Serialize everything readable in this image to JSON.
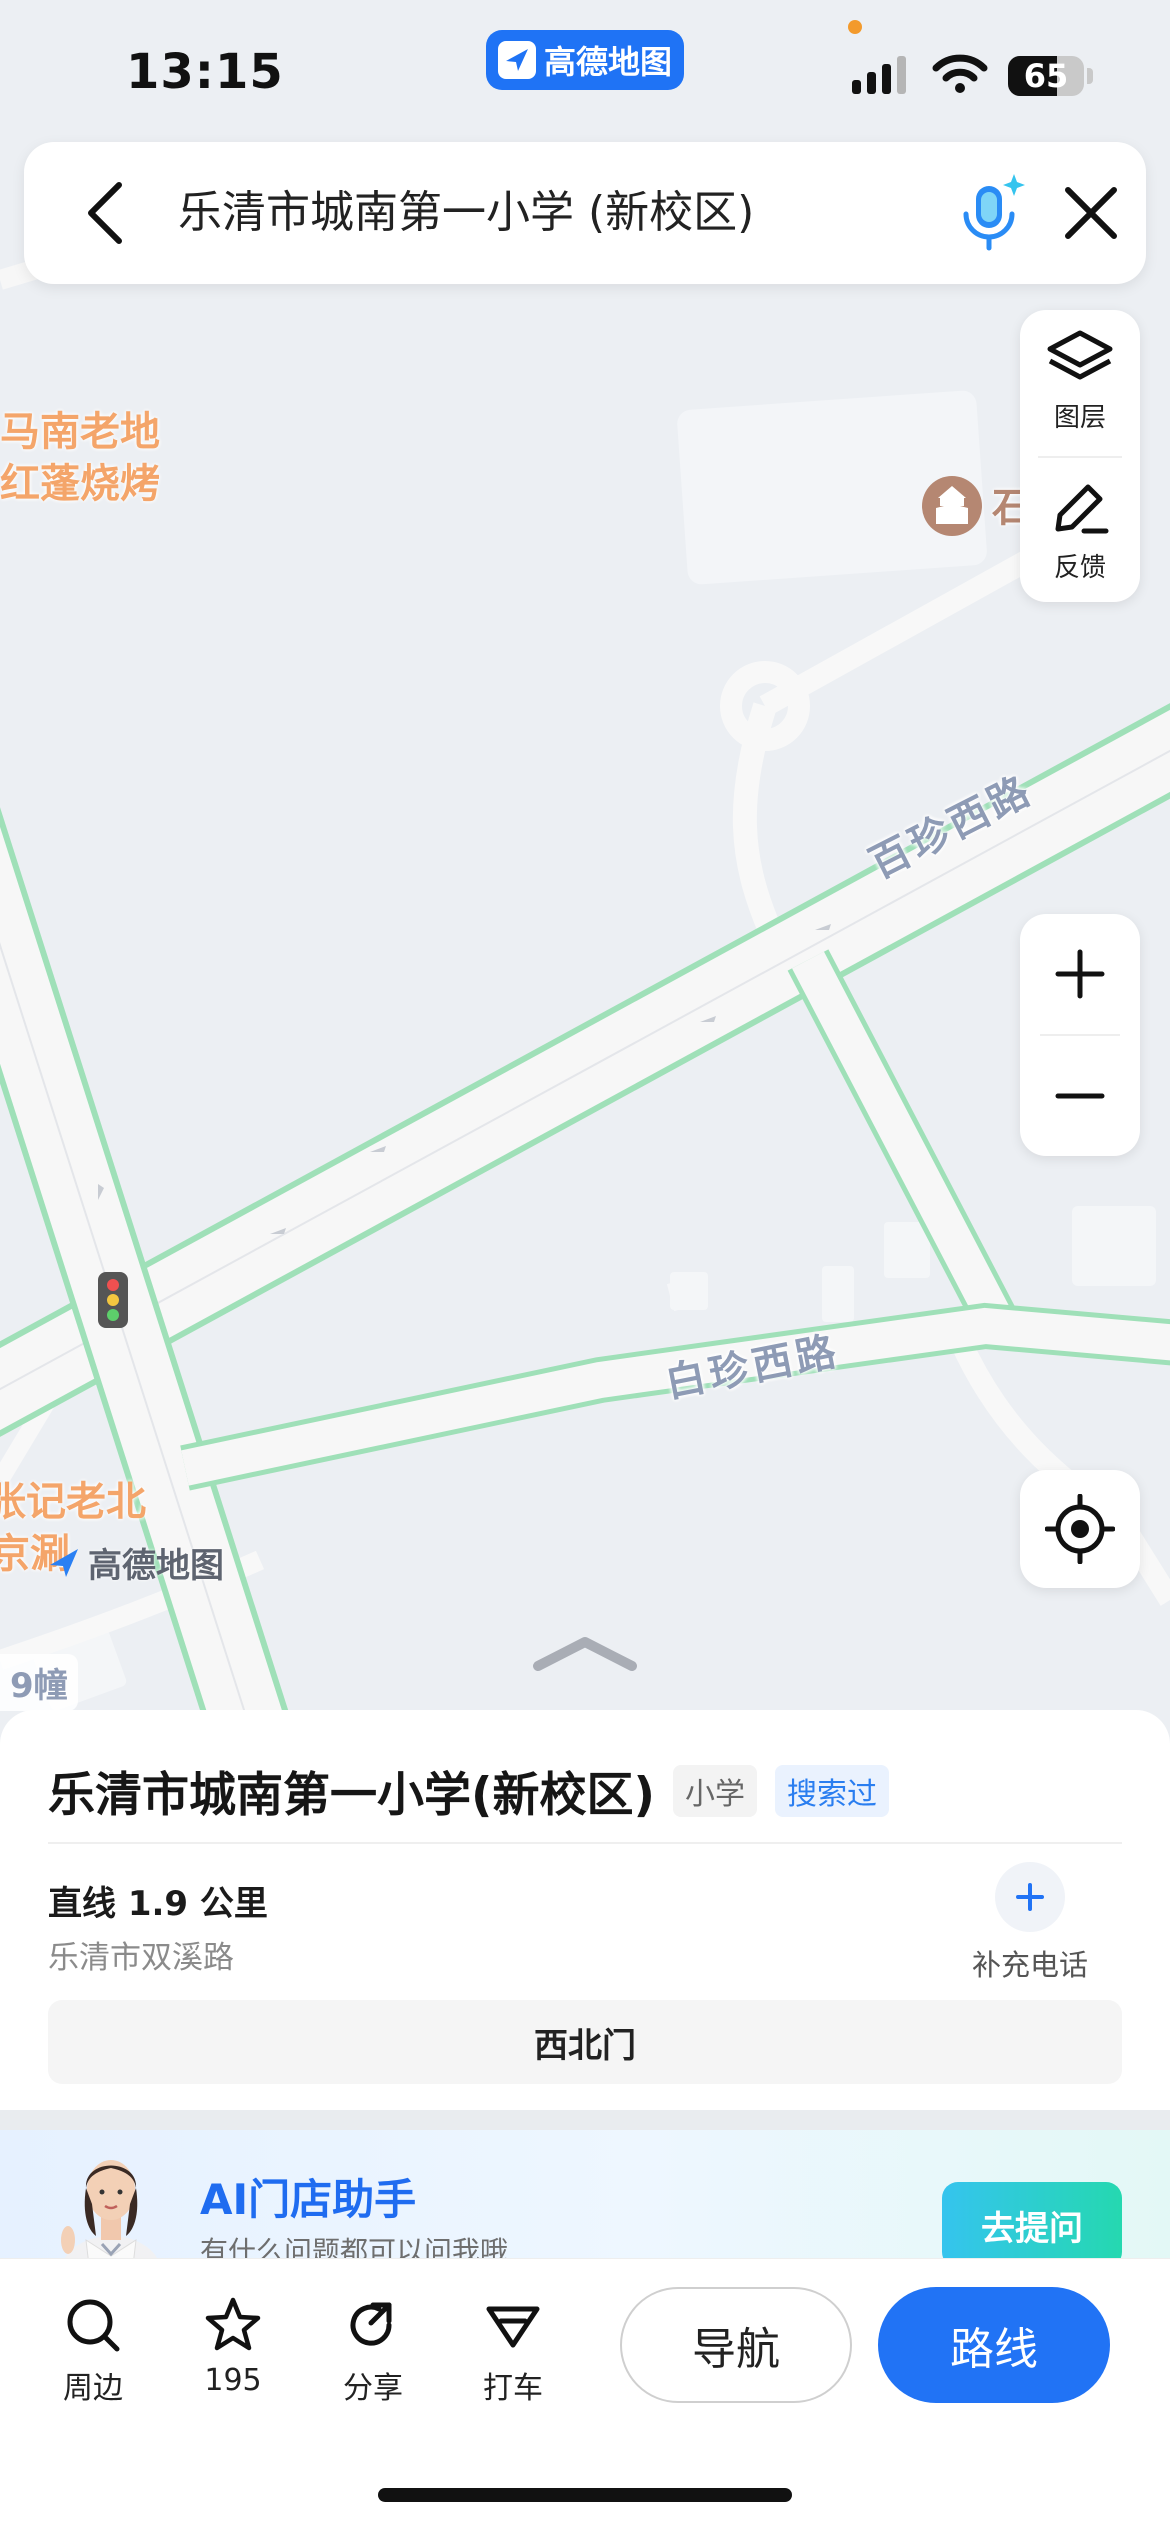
{
  "status_bar": {
    "time": "13:15",
    "app_name": "高德地图",
    "battery": "65",
    "battery_level": 0.65
  },
  "search": {
    "query": "乐清市城南第一小学 (新校区)"
  },
  "map_controls": {
    "layers_label": "图层",
    "feedback_label": "反馈"
  },
  "map": {
    "pois": [
      {
        "text": "马南老地"
      },
      {
        "text": "红蓬烧烤"
      },
      {
        "text": "张记老北"
      },
      {
        "text": "京涮"
      }
    ],
    "roads": [
      "百珍西路",
      "白珍西路"
    ],
    "watermark": "高德地图",
    "building_label": "9幢",
    "partial_poi": "石"
  },
  "place": {
    "name": "乐清市城南第一小学(新校区)",
    "category_tag": "小学",
    "history_tag": "搜索过",
    "distance": "直线 1.9 公里",
    "address": "乐清市双溪路",
    "add_phone": "补充电话",
    "gate": "西北门"
  },
  "ai_banner": {
    "title": "AI门店助手",
    "subtitle": "有什么问题都可以问我哦",
    "ask_button": "去提问"
  },
  "bottom_bar": {
    "nearby": "周边",
    "favorites_count": "195",
    "share": "分享",
    "taxi": "打车",
    "navigate": "导航",
    "route": "路线"
  },
  "colors": {
    "accent": "#2173f5",
    "road_edge": "#9fe0b8",
    "poi_text": "#f4a56a"
  }
}
